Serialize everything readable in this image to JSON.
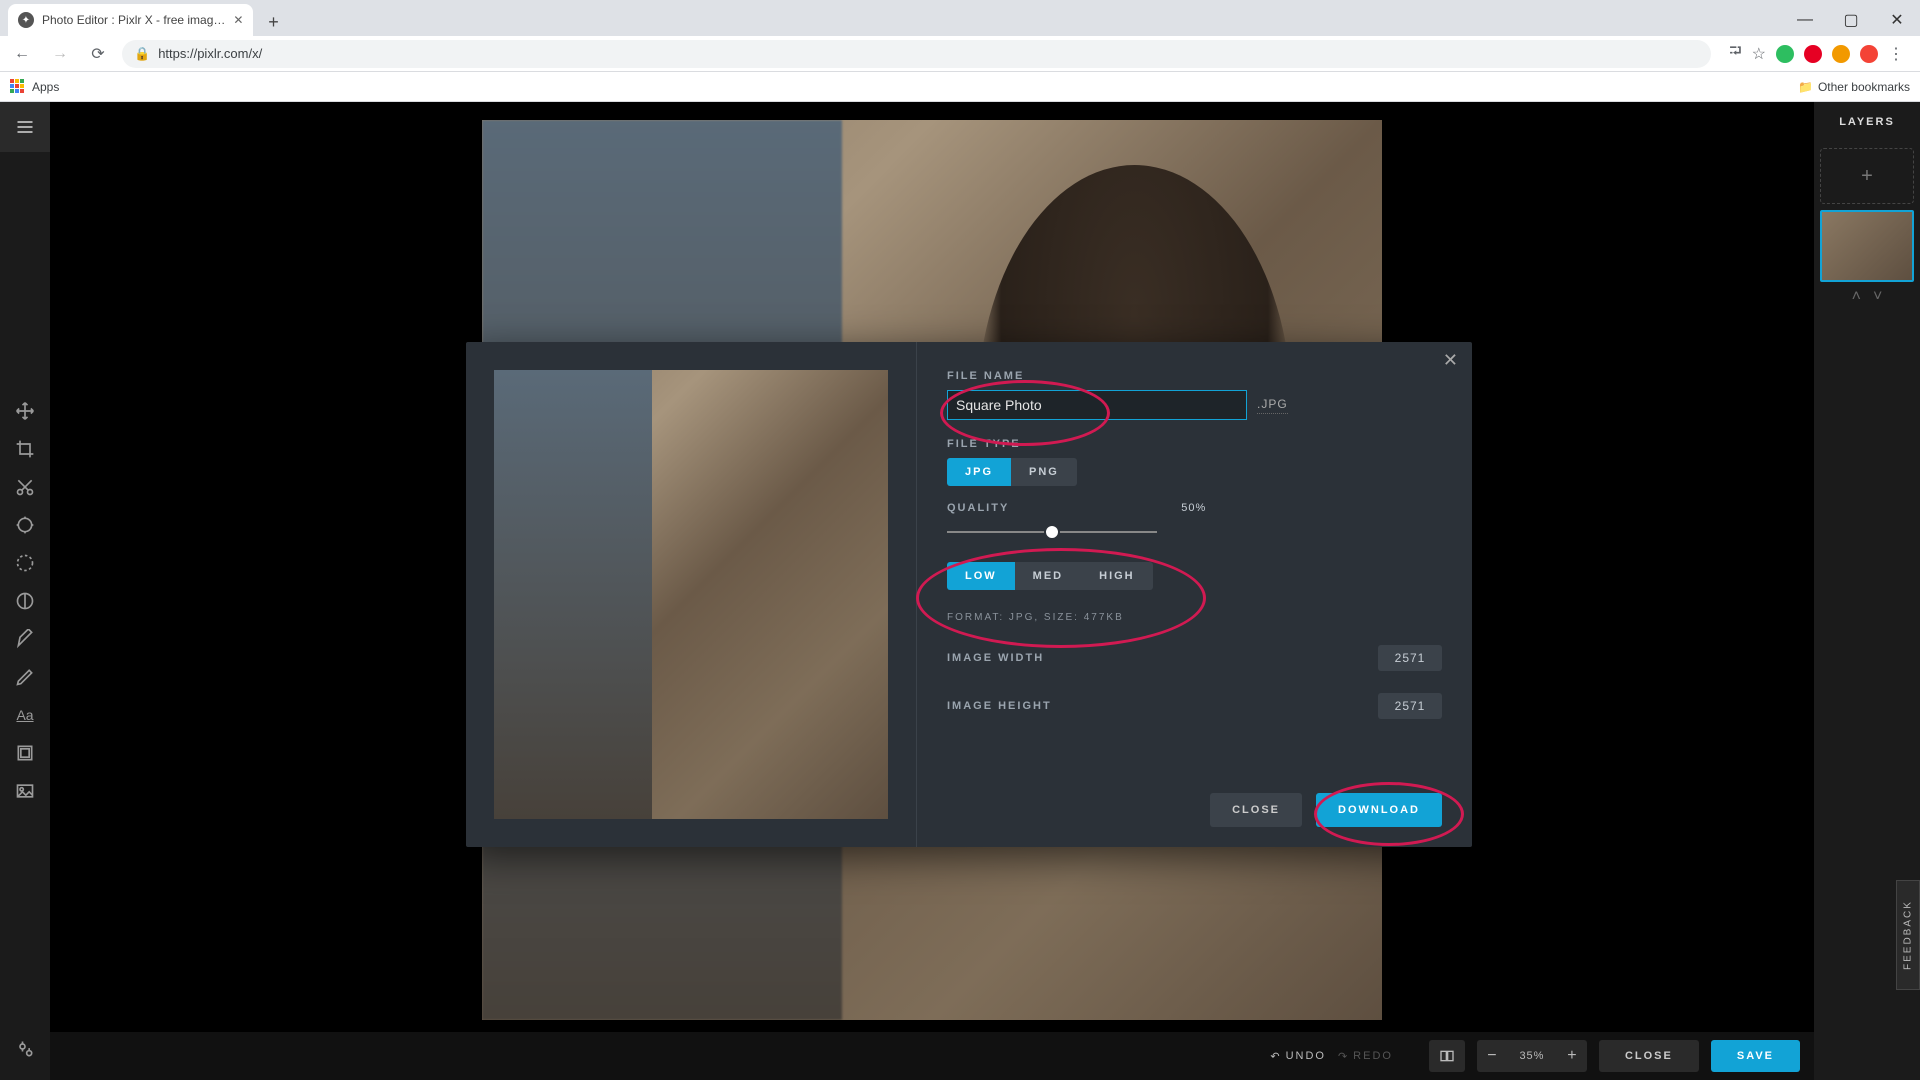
{
  "browser": {
    "tab_title": "Photo Editor : Pixlr X - free imag…",
    "url": "https://pixlr.com/x/",
    "apps_label": "Apps",
    "other_bookmarks": "Other bookmarks"
  },
  "toolbar_icons": [
    "move",
    "crop",
    "cut",
    "adjust",
    "effect",
    "contrast",
    "brush",
    "draw",
    "text",
    "frame",
    "image"
  ],
  "right_panel": {
    "title": "LAYERS"
  },
  "bottom_bar": {
    "undo": "UNDO",
    "redo": "REDO",
    "zoom": "35%",
    "close": "CLOSE",
    "save": "SAVE"
  },
  "feedback": "FEEDBACK",
  "modal": {
    "file_name_label": "FILE NAME",
    "file_name_value": "Square Photo",
    "file_ext": ".JPG",
    "file_type_label": "FILE TYPE",
    "file_type_options": [
      "JPG",
      "PNG"
    ],
    "file_type_selected": "JPG",
    "quality_label": "QUALITY",
    "quality_value": "50%",
    "quality_options": [
      "LOW",
      "MED",
      "HIGH"
    ],
    "quality_selected": "LOW",
    "format_line": "FORMAT: JPG, SIZE: 477KB",
    "width_label": "IMAGE WIDTH",
    "width_value": "2571",
    "height_label": "IMAGE HEIGHT",
    "height_value": "2571",
    "close": "CLOSE",
    "download": "DOWNLOAD"
  }
}
